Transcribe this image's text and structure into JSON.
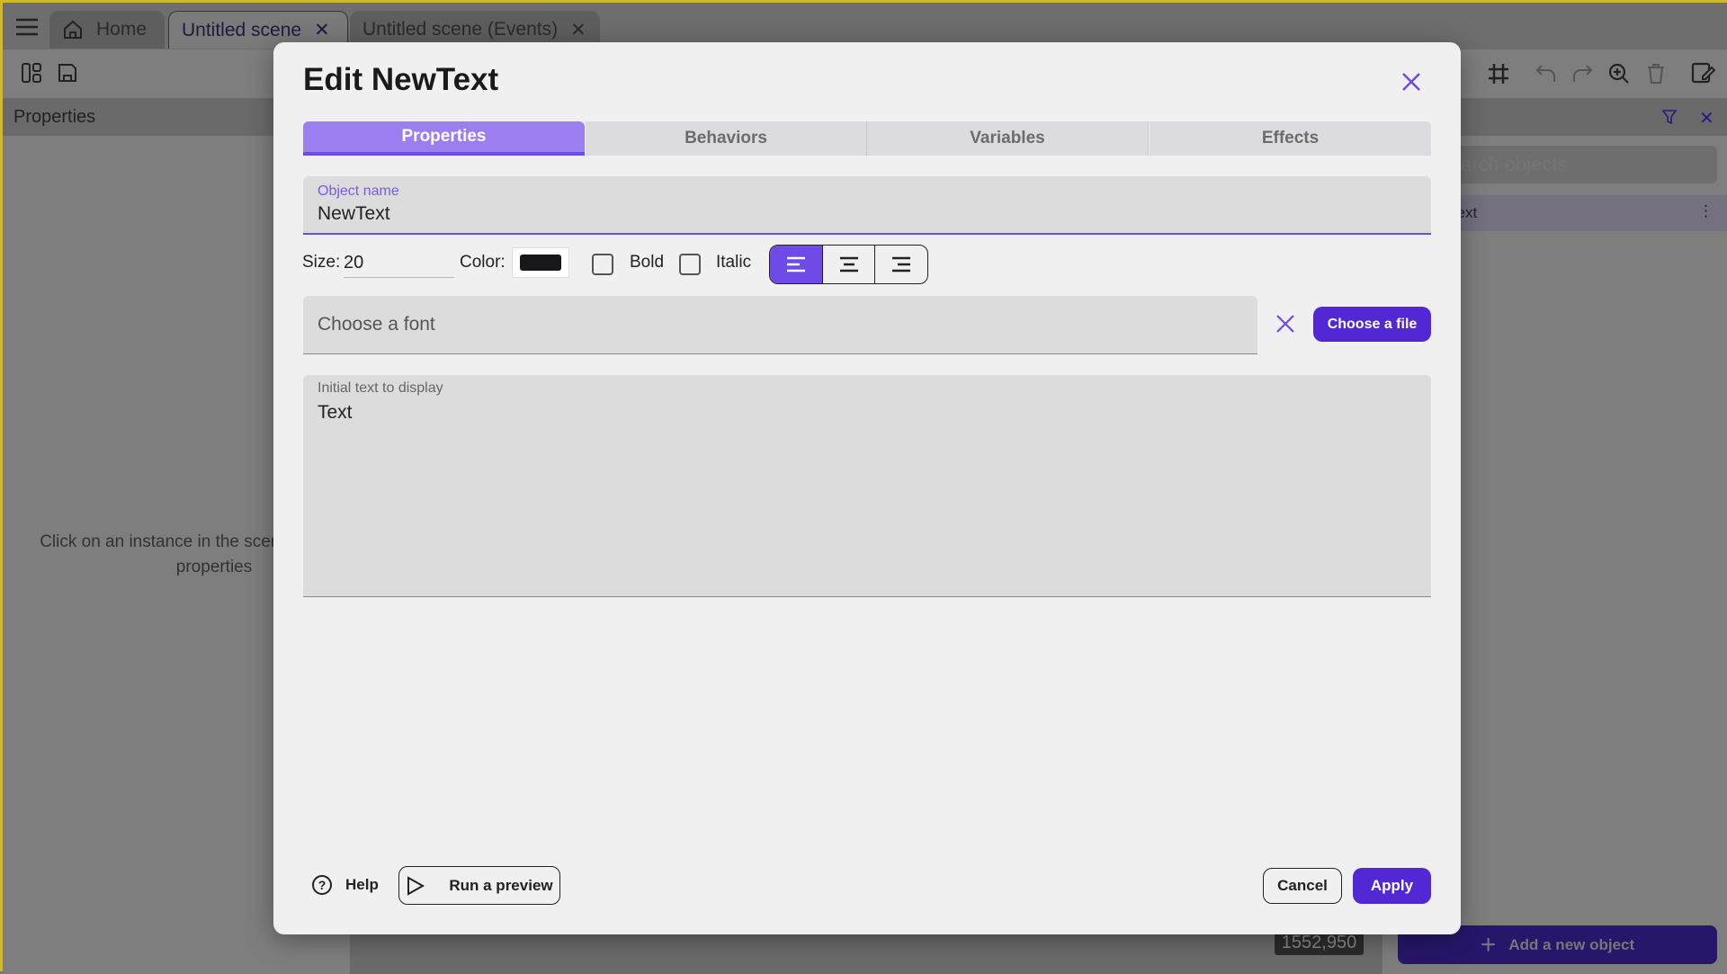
{
  "app": {
    "tabs": [
      {
        "label": "Home",
        "icon": "home-icon"
      },
      {
        "label": "Untitled scene",
        "active": true
      },
      {
        "label": "Untitled scene (Events)"
      }
    ],
    "left_panel": {
      "title": "Properties",
      "empty_message": "Click on an instance in the scene to display its properties"
    },
    "right_panel": {
      "search_placeholder": "Search objects",
      "objects": [
        "NewText"
      ],
      "add_button": "Add a new object"
    },
    "canvas": {
      "coordinates": "1552,950"
    }
  },
  "dialog": {
    "title": "Edit NewText",
    "tabs": [
      "Properties",
      "Behaviors",
      "Variables",
      "Effects"
    ],
    "active_tab": "Properties",
    "object_name": {
      "label": "Object name",
      "value": "NewText"
    },
    "size": {
      "label": "Size:",
      "value": "20"
    },
    "color": {
      "label": "Color:",
      "value": "#18171c"
    },
    "bold": {
      "label": "Bold",
      "checked": false
    },
    "italic": {
      "label": "Italic",
      "checked": false
    },
    "alignment": {
      "options": [
        "left",
        "center",
        "right"
      ],
      "selected": "left"
    },
    "font": {
      "placeholder": "Choose a font",
      "choose_file": "Choose a file"
    },
    "text": {
      "label": "Initial text to display",
      "value": "Text"
    },
    "footer": {
      "help": "Help",
      "preview": "Run a preview",
      "cancel": "Cancel",
      "apply": "Apply"
    }
  },
  "colors": {
    "accent": "#5128d4",
    "tab_active": "#9b7ff0",
    "highlight": "#6e4ae6"
  }
}
